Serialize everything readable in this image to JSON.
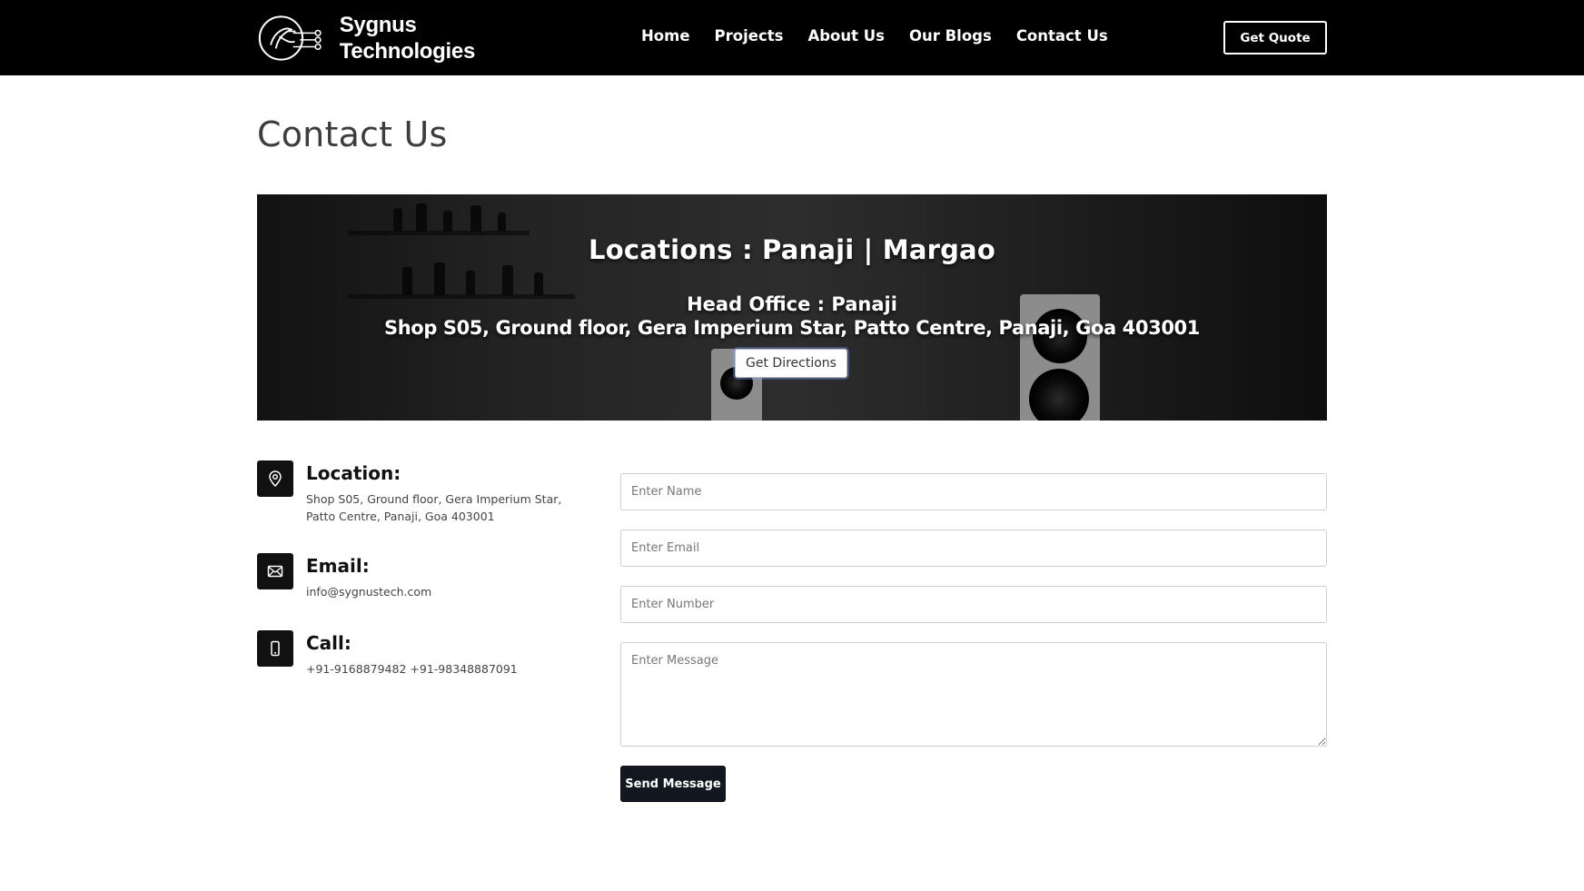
{
  "brand": {
    "line1": "Sygnus",
    "line2": "Technologies"
  },
  "nav": [
    {
      "label": "Home"
    },
    {
      "label": "Projects"
    },
    {
      "label": "About Us"
    },
    {
      "label": "Our Blogs"
    },
    {
      "label": "Contact Us"
    }
  ],
  "header": {
    "quote_label": "Get Quote"
  },
  "page": {
    "title": "Contact Us"
  },
  "hero": {
    "locations": "Locations : Panaji | Margao",
    "office": "Head Office : Panaji",
    "address": "Shop S05, Ground floor, Gera Imperium Star, Patto Centre, Panaji, Goa 403001",
    "directions_label": "Get Directions"
  },
  "info": {
    "location": {
      "heading": "Location:",
      "text": "Shop S05, Ground floor, Gera Imperium Star, Patto Centre, Panaji, Goa 403001",
      "icon": "map-pin-icon"
    },
    "email": {
      "heading": "Email:",
      "text": "info@sygnustech.com",
      "icon": "envelope-icon"
    },
    "call": {
      "heading": "Call:",
      "text": "+91-9168879482 +91-98348887091",
      "icon": "mobile-phone-icon"
    }
  },
  "form": {
    "name_placeholder": "Enter Name",
    "email_placeholder": "Enter Email",
    "number_placeholder": "Enter Number",
    "message_placeholder": "Enter Message",
    "send_label": "Send Message"
  },
  "colors": {
    "header_bg": "#000000",
    "button_dark": "#111820",
    "text_dark": "#3d3d3d"
  }
}
